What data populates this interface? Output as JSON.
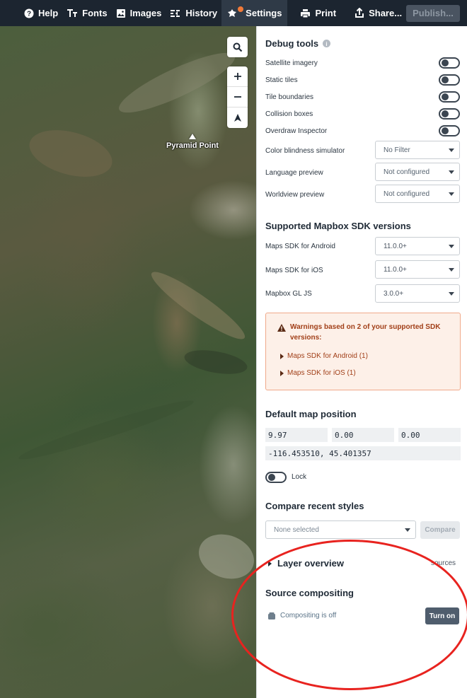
{
  "toolbar": {
    "help": "Help",
    "fonts": "Fonts",
    "images": "Images",
    "history": "History",
    "settings": "Settings",
    "print": "Print",
    "share": "Share...",
    "publish": "Publish..."
  },
  "map": {
    "poi_label": "Pyramid Point"
  },
  "debug": {
    "title": "Debug tools",
    "satellite": "Satellite imagery",
    "static_tiles": "Static tiles",
    "tile_boundaries": "Tile boundaries",
    "collision_boxes": "Collision boxes",
    "overdraw": "Overdraw Inspector",
    "color_blind_label": "Color blindness simulator",
    "color_blind_value": "No Filter",
    "language_label": "Language preview",
    "language_value": "Not configured",
    "worldview_label": "Worldview preview",
    "worldview_value": "Not configured"
  },
  "sdk": {
    "title": "Supported Mapbox SDK versions",
    "android_label": "Maps SDK for Android",
    "android_value": "11.0.0+",
    "ios_label": "Maps SDK for iOS",
    "ios_value": "11.0.0+",
    "gljs_label": "Mapbox GL JS",
    "gljs_value": "3.0.0+"
  },
  "warnings": {
    "title": "Warnings based on 2 of your supported SDK versions:",
    "item1": "Maps SDK for Android (1)",
    "item2": "Maps SDK for iOS (1)"
  },
  "position": {
    "title": "Default map position",
    "zoom": "9.97",
    "bearing": "0.00",
    "pitch": "0.00",
    "center": "-116.453510, 45.401357",
    "lock_label": "Lock"
  },
  "compare": {
    "title": "Compare recent styles",
    "select_value": "None selected",
    "button": "Compare"
  },
  "layer_overview": {
    "title": "Layer overview",
    "sources_suffix": "sources"
  },
  "compositing": {
    "title": "Source compositing",
    "status": "Compositing is off",
    "button": "Turn on"
  },
  "colors": {
    "toolbar_bg": "#1c2530",
    "accent_dot": "#f17a38",
    "warning_text": "#a13f18",
    "annotation": "#e8231f"
  }
}
